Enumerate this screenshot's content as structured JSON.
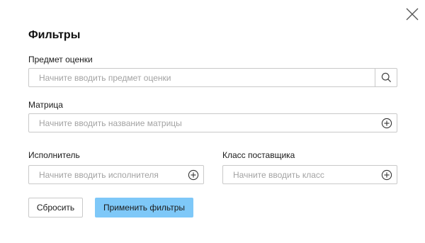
{
  "dialog": {
    "title": "Фильтры",
    "close_icon": "close-icon"
  },
  "fields": {
    "subject": {
      "label": "Предмет оценки",
      "placeholder": "Начните вводить предмет оценки",
      "value": "",
      "icon": "search-icon"
    },
    "matrix": {
      "label": "Матрица",
      "placeholder": "Начните вводить название матрицы",
      "value": "",
      "icon": "plus-circle-icon"
    },
    "executor": {
      "label": "Исполнитель",
      "placeholder": "Начните вводить исполнителя",
      "value": "",
      "icon": "plus-circle-icon"
    },
    "supplier_class": {
      "label": "Класс поставщика",
      "placeholder": "Начните вводить класс",
      "value": "",
      "icon": "plus-circle-icon"
    }
  },
  "buttons": {
    "reset_label": "Сбросить",
    "apply_label": "Применить фильтры"
  },
  "colors": {
    "apply_button_bg": "#7ec8f8",
    "border": "#c9c9c9",
    "placeholder": "#a3a3a3"
  }
}
